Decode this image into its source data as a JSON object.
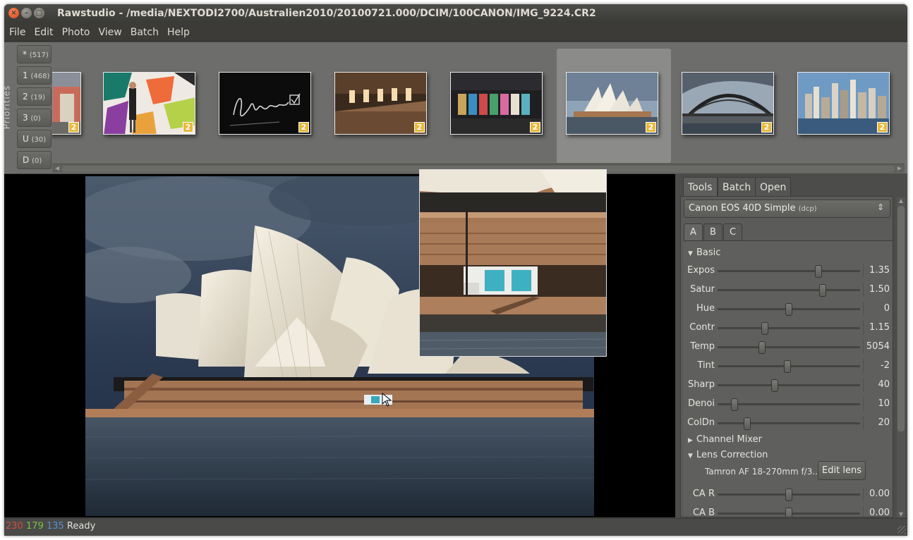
{
  "window": {
    "title": "Rawstudio - /media/NEXTODI2700/Australien2010/20100721.000/DCIM/100CANON/IMG_9224.CR2"
  },
  "menu": [
    "File",
    "Edit",
    "Photo",
    "View",
    "Batch",
    "Help"
  ],
  "priorities": {
    "label": "Priorities",
    "buttons": [
      {
        "label": "*",
        "count": "(517)"
      },
      {
        "label": "1",
        "count": "(468)"
      },
      {
        "label": "2",
        "count": "(19)"
      },
      {
        "label": "3",
        "count": "(0)"
      },
      {
        "label": "U",
        "count": "(30)"
      },
      {
        "label": "D",
        "count": "(0)"
      }
    ]
  },
  "thumbnails": {
    "badge": "2",
    "items": [
      "exhibition-hall",
      "woman-colorful-wall",
      "handwritten-signature",
      "hallway-interior",
      "colorful-posters",
      "sydney-opera-house",
      "harbour-bridge",
      "sydney-skyline"
    ],
    "selected_index": 5
  },
  "panel": {
    "tabs": [
      "Tools",
      "Batch",
      "Open"
    ],
    "active_tab": "Tools",
    "profile": {
      "name": "Canon EOS 40D Simple",
      "type": "(dcp)"
    },
    "subtabs": [
      "A",
      "B",
      "C"
    ],
    "active_subtab": "A",
    "sections": {
      "basic": "Basic",
      "channel_mixer": "Channel Mixer",
      "lens_correction": "Lens Correction"
    },
    "sliders": [
      {
        "label": "Expos",
        "value": "1.35",
        "position": 0.71
      },
      {
        "label": "Satur",
        "value": "1.50",
        "position": 0.74
      },
      {
        "label": "Hue",
        "value": "0",
        "position": 0.5
      },
      {
        "label": "Contr",
        "value": "1.15",
        "position": 0.33
      },
      {
        "label": "Temp",
        "value": "5054",
        "position": 0.31
      },
      {
        "label": "Tint",
        "value": "-2",
        "position": 0.49
      },
      {
        "label": "Sharp",
        "value": "40",
        "position": 0.4
      },
      {
        "label": "Denoi",
        "value": "10",
        "position": 0.12
      },
      {
        "label": "ColDn",
        "value": "20",
        "position": 0.21
      }
    ],
    "lens": {
      "name": "Tamron AF 18-270mm f/3...",
      "edit_label": "Edit lens",
      "sliders": [
        {
          "label": "CA R",
          "value": "0.00",
          "position": 0.5
        },
        {
          "label": "CA B",
          "value": "0.00",
          "position": 0.5
        }
      ]
    }
  },
  "status": {
    "r": "230",
    "g": "179",
    "b": "135",
    "text": "Ready"
  },
  "colors": {
    "accent_close": "#e9541b",
    "badge": "#e8b93a",
    "status_r": "#d84a3f",
    "status_g": "#7bc142",
    "status_b": "#5b8ed6"
  }
}
